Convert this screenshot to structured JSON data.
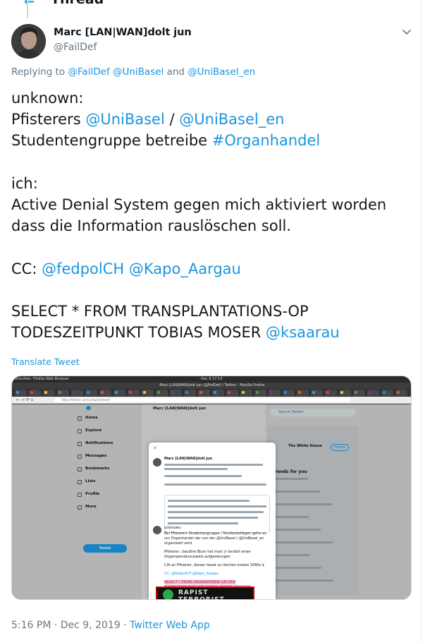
{
  "header": {
    "title": "Thread"
  },
  "tweet": {
    "author_name": "Marc [LAN|WAN]dolt jun",
    "author_handle": "@FailDef",
    "replying_prefix": "Replying to",
    "replying_to": [
      "@FailDef",
      "@UniBasel",
      "@UniBasel_en"
    ],
    "replying_joiner": "and",
    "lines": [
      [
        {
          "t": "unknown:"
        }
      ],
      [
        {
          "t": "Pfisterers "
        },
        {
          "t": "@UniBasel",
          "link": true
        },
        {
          "t": " / "
        },
        {
          "t": "@UniBasel_en",
          "link": true
        }
      ],
      [
        {
          "t": "Studentengruppe betreibe "
        },
        {
          "t": "#Organhandel",
          "link": true
        }
      ],
      [
        {
          "t": ""
        }
      ],
      [
        {
          "t": "ich:"
        }
      ],
      [
        {
          "t": "Active Denial System gegen mich aktiviert worden"
        }
      ],
      [
        {
          "t": "dass die Information rauslöschen soll."
        }
      ],
      [
        {
          "t": ""
        }
      ],
      [
        {
          "t": "CC: "
        },
        {
          "t": "@fedpolCH",
          "link": true
        },
        {
          "t": " "
        },
        {
          "t": "@Kapo_Aargau",
          "link": true
        }
      ],
      [
        {
          "t": ""
        }
      ],
      [
        {
          "t": "SELECT * FROM TRANSPLANTATIONS-OP"
        }
      ],
      [
        {
          "t": "TODESZEITPUNKT TOBIAS MOSER "
        },
        {
          "t": "@ksaarau",
          "link": true
        }
      ]
    ],
    "translate_label": "Translate Tweet",
    "timestamp": "5:16 PM · Dec 9, 2019",
    "separator": " · ",
    "source_app": "Twitter Web App"
  },
  "screenshot": {
    "activities": "Activities",
    "browser_label": "Firefox Web Browser",
    "clock": "Dec 9  17:13",
    "window_title": "Marc [LAN|WAN]dolt jun (@FailDef) / Twitter - Mozilla Firefox",
    "url": "https://twitter.com/compose/tweet",
    "profile_header": "Marc [LAN|WAN]dolt jun",
    "search_placeholder": "Search Twitter",
    "nav": [
      "Home",
      "Explore",
      "Notifications",
      "Messages",
      "Bookmarks",
      "Lists",
      "Profile",
      "More"
    ],
    "tweet_button": "Tweet",
    "suggested_name": "The White House",
    "follow": "Follow",
    "trends_title": "Trends for you",
    "modal_author": "Marc [LAN|WAN]dolt jun",
    "modal_lines": [
      "unknown:",
      "Bei Pfisterers Studentengruppe / Studienkollegen gehe es",
      "um Organhandel der von der @UniBasel / @UniBasel_en",
      "organisiert wird",
      "Pfisterer: claudine Blum hat marc jr landolt einen",
      "Organspenderausweis aufgezwungen",
      "CIA an Pfisterer, diesen tweet zu löschen kosten 50Mio $",
      "CC: @fedpolCH @Kapo_Aargau",
      "SELECT * FROM ORGANSPENDE UM DEN",
      "TODESZEITPUNKT VON TOBIAS MOSER @ksaarau"
    ],
    "banner_text": "RAPIST TERRORIST"
  },
  "colors": {
    "link": "#1b95e0",
    "muted": "#657786",
    "text": "#14171a",
    "twitter_blue": "#1da1f2"
  }
}
